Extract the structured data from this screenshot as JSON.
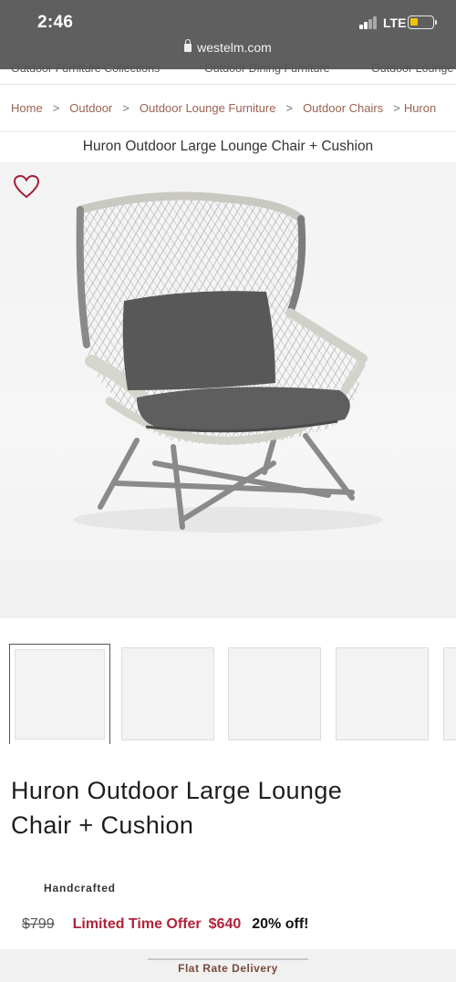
{
  "status": {
    "time": "2:46",
    "network": "LTE",
    "url": "westelm.com"
  },
  "category_nav": [
    "Outdoor Furniture Collections",
    "Outdoor Dining Furniture",
    "Outdoor Lounge"
  ],
  "breadcrumb": [
    "Home",
    "Outdoor",
    "Outdoor Lounge Furniture",
    "Outdoor Chairs",
    "Huron"
  ],
  "breadcrumb_separator": ">",
  "top_title": "Huron Outdoor Large Lounge Chair + Cushion",
  "product": {
    "title_line1": "Huron Outdoor Large Lounge",
    "title_line2": "Chair + Cushion",
    "badge": "Handcrafted",
    "old_price": "$799",
    "offer_label": "Limited Time Offer",
    "sale_price": "$640",
    "discount": "20% off!"
  },
  "delivery": "Flat Rate Delivery",
  "colors": {
    "accent_red": "#b0233b",
    "breadcrumb_link": "#9a6352",
    "status_bar": "#5f5f5f"
  }
}
